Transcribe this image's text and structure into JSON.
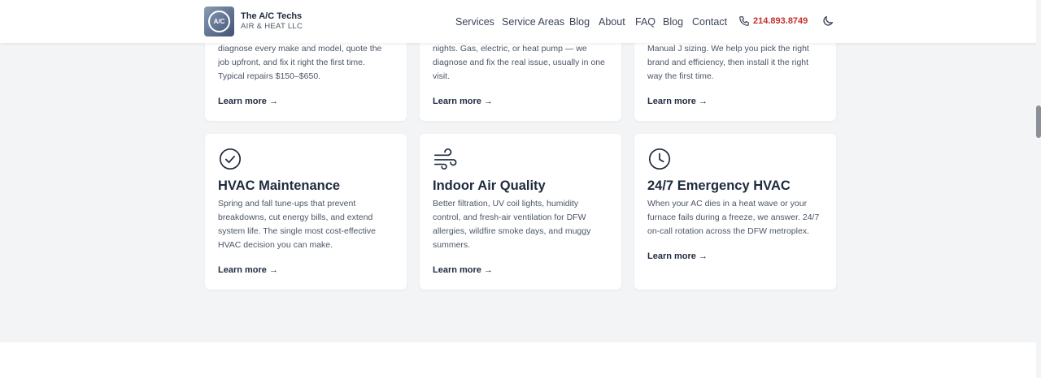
{
  "brand": {
    "name": "The A/C Techs",
    "sub": "AIR & HEAT LLC",
    "badge": "A/C"
  },
  "nav": [
    {
      "label": "Services"
    },
    {
      "label": "Service Areas"
    },
    {
      "label": "Blog"
    },
    {
      "label": "About"
    },
    {
      "label": "FAQ"
    },
    {
      "label": "Blog"
    },
    {
      "label": "Contact"
    }
  ],
  "phone": "214.893.8749",
  "colors": {
    "accent": "#c53030",
    "ink": "#1f2a3d",
    "muted": "#4b5567",
    "card": "#ffffff",
    "page": "#f3f4f6"
  },
  "cards_top": [
    {
      "desc": "diagnose every make and model, quote the job upfront, and fix it right the first time. Typical repairs $150–$650.",
      "more": "Learn more →"
    },
    {
      "desc": "nights. Gas, electric, or heat pump — we diagnose and fix the real issue, usually in one visit.",
      "more": "Learn more →"
    },
    {
      "desc": "Manual J sizing. We help you pick the right brand and efficiency, then install it the right way the first time.",
      "more": "Learn more →"
    }
  ],
  "cards_bottom": [
    {
      "icon": "check-circle-icon",
      "title": "HVAC Maintenance",
      "desc": "Spring and fall tune-ups that prevent breakdowns, cut energy bills, and extend system life. The single most cost-effective HVAC decision you can make.",
      "more": "Learn more →"
    },
    {
      "icon": "wind-icon",
      "title": "Indoor Air Quality",
      "desc": "Better filtration, UV coil lights, humidity control, and fresh-air ventilation for DFW allergies, wildfire smoke days, and muggy summers.",
      "more": "Learn more →"
    },
    {
      "icon": "clock-icon",
      "title": "24/7 Emergency HVAC",
      "desc": "When your AC dies in a heat wave or your furnace fails during a freeze, we answer. 24/7 on-call rotation across the DFW metroplex.",
      "more": "Learn more →"
    }
  ]
}
